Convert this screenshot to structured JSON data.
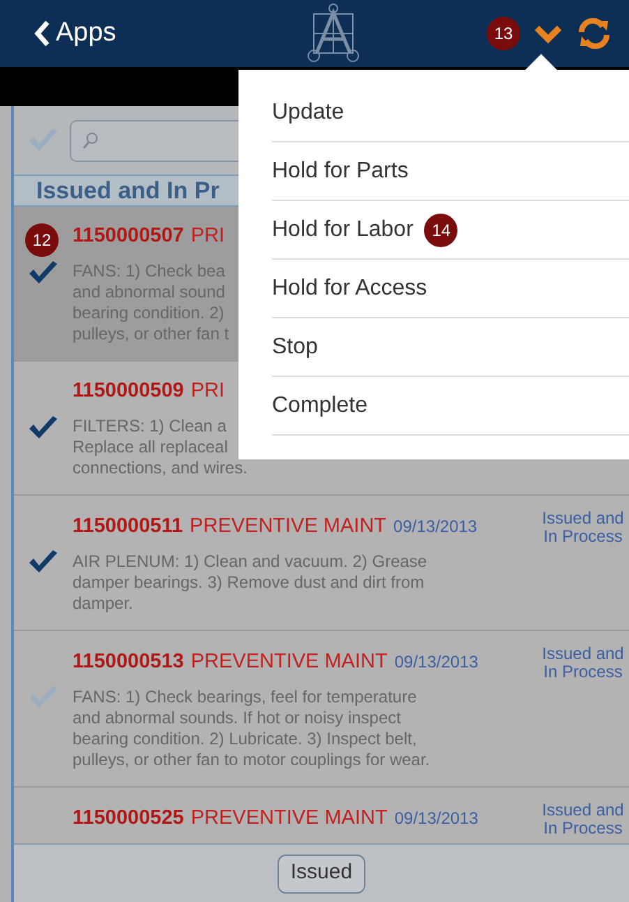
{
  "header": {
    "back_label": "Apps",
    "badge": "13"
  },
  "search": {
    "check_all": false
  },
  "section": {
    "title": "Issued and In Pr"
  },
  "rows": [
    {
      "number": "1150000507",
      "type": "PRI",
      "selected": true,
      "checked": true,
      "badge": "12",
      "description_lines": [
        "FANS: 1) Check bea",
        "and abnormal sound",
        "bearing condition. 2)",
        "pulleys, or other fan t"
      ]
    },
    {
      "number": "1150000509",
      "type": "PRI",
      "selected": false,
      "checked": true,
      "description_lines": [
        "FILTERS: 1) Clean a",
        "Replace all replaceal",
        "connections, and wires."
      ]
    },
    {
      "number": "1150000511",
      "type": "PREVENTIVE MAINT",
      "date": "09/13/2013",
      "status": "Issued and In Process",
      "selected": false,
      "checked": true,
      "description_lines": [
        "AIR PLENUM: 1) Clean and vacuum. 2) Grease damper bearings. 3) Remove dust and dirt from damper."
      ]
    },
    {
      "number": "1150000513",
      "type": "PREVENTIVE MAINT",
      "date": "09/13/2013",
      "status": "Issued and In Process",
      "selected": false,
      "checked": false,
      "description_lines": [
        "FANS: 1) Check bearings, feel for temperature and abnormal sounds. If hot or noisy inspect bearing condition. 2) Lubricate. 3) Inspect belt, pulleys, or other fan to motor couplings for wear."
      ]
    },
    {
      "number": "1150000525",
      "type": "PREVENTIVE MAINT",
      "date": "09/13/2013",
      "status": "Issued and In Process",
      "selected": false
    }
  ],
  "footer": {
    "button": "Issued"
  },
  "menu": {
    "items": [
      {
        "label": "Update"
      },
      {
        "label": "Hold for Parts"
      },
      {
        "label": "Hold for Labor",
        "badge": "14"
      },
      {
        "label": "Hold for Access"
      },
      {
        "label": "Stop"
      },
      {
        "label": "Complete"
      }
    ]
  }
}
